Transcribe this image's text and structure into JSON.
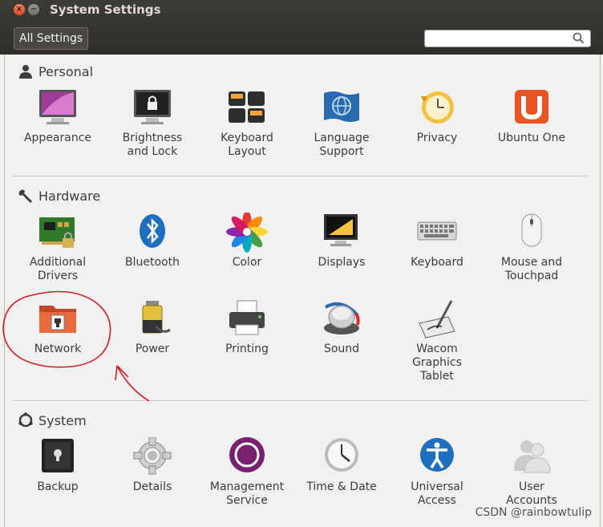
{
  "window": {
    "title": "System Settings"
  },
  "toolbar": {
    "all_settings_label": "All Settings",
    "search_value": ""
  },
  "sections": {
    "personal": {
      "title": "Personal",
      "items": [
        {
          "label": "Appearance",
          "icon": "appearance-icon"
        },
        {
          "label": "Brightness\nand Lock",
          "icon": "brightness-lock-icon"
        },
        {
          "label": "Keyboard\nLayout",
          "icon": "keyboard-layout-icon"
        },
        {
          "label": "Language\nSupport",
          "icon": "language-support-icon"
        },
        {
          "label": "Privacy",
          "icon": "privacy-icon"
        },
        {
          "label": "Ubuntu One",
          "icon": "ubuntu-one-icon"
        }
      ]
    },
    "hardware": {
      "title": "Hardware",
      "items": [
        {
          "label": "Additional\nDrivers",
          "icon": "additional-drivers-icon"
        },
        {
          "label": "Bluetooth",
          "icon": "bluetooth-icon"
        },
        {
          "label": "Color",
          "icon": "color-icon"
        },
        {
          "label": "Displays",
          "icon": "displays-icon"
        },
        {
          "label": "Keyboard",
          "icon": "keyboard-icon"
        },
        {
          "label": "Mouse and\nTouchpad",
          "icon": "mouse-icon"
        },
        {
          "label": "Network",
          "icon": "network-icon"
        },
        {
          "label": "Power",
          "icon": "power-icon"
        },
        {
          "label": "Printing",
          "icon": "printer-icon"
        },
        {
          "label": "Sound",
          "icon": "sound-icon"
        },
        {
          "label": "Wacom\nGraphics\nTablet",
          "icon": "wacom-tablet-icon"
        }
      ]
    },
    "system": {
      "title": "System",
      "items": [
        {
          "label": "Backup",
          "icon": "backup-icon"
        },
        {
          "label": "Details",
          "icon": "details-gear-icon"
        },
        {
          "label": "Management\nService",
          "icon": "management-service-icon"
        },
        {
          "label": "Time & Date",
          "icon": "clock-icon"
        },
        {
          "label": "Universal\nAccess",
          "icon": "universal-access-icon"
        },
        {
          "label": "User\nAccounts",
          "icon": "user-accounts-icon"
        }
      ]
    }
  },
  "watermark": "CSDN @rainbowtulip",
  "colors": {
    "titlebar": "#3c3b37",
    "content_bg": "#f2f1f0",
    "annotation_red": "#d01c24",
    "ubuntu_orange": "#e95420"
  }
}
